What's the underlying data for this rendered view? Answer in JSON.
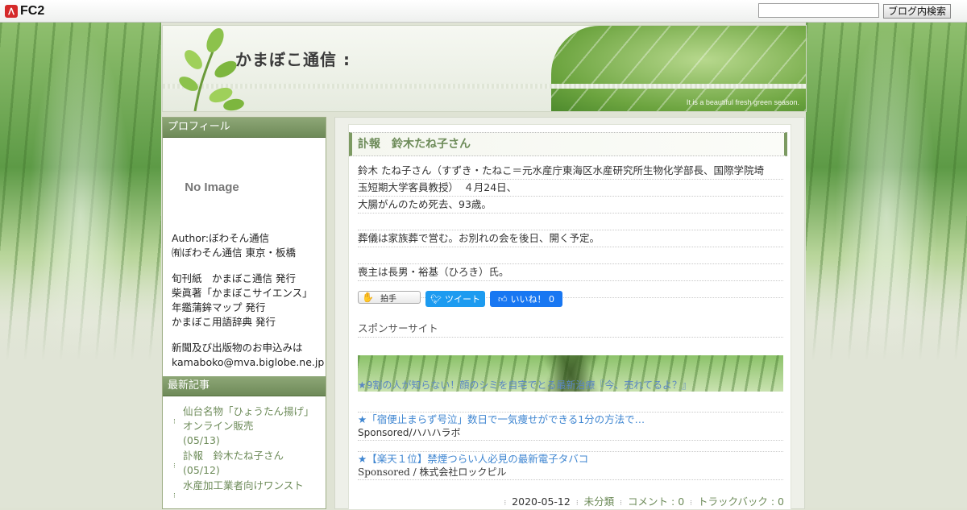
{
  "fc2_bar": {
    "logo_text": "FC2",
    "search_placeholder": "",
    "search_button": "ブログ内検索"
  },
  "header": {
    "site_title": "かまぼこ通信 :",
    "tagline": "It is a beautiful fresh green season."
  },
  "sidebar": {
    "profile_heading": "プロフィール",
    "no_image_text": "No Image",
    "author_lines": [
      "Author:ぼわそん通信",
      "㈲ぼわそん通信 東京・板橋"
    ],
    "publication_lines": [
      "旬刊紙　かまぼこ通信 発行",
      "柴眞著「かまぼこサイエンス」",
      "年鑑蒲鉾マップ 発行",
      "かまぼこ用語辞典 発行"
    ],
    "contact_lines": [
      "新聞及び出版物のお申込みは",
      "kamaboko@mva.biglobe.ne.jp"
    ],
    "recent_heading": "最新記事",
    "recent_items": [
      {
        "title": "仙台名物「ひょうたん揚げ」　オンライン販売",
        "date": "(05/13)"
      },
      {
        "title": "訃報　鈴木たね子さん",
        "date": "(05/12)"
      },
      {
        "title": "水産加工業者向けワンスト",
        "date": ""
      }
    ]
  },
  "entry": {
    "title": "訃報　鈴木たね子さん",
    "body_lines": [
      "鈴木 たね子さん（すずき・たねこ＝元水産庁東海区水産研究所生物化学部長、国際学院埼",
      "玉短期大学客員教授）　４月24日、",
      "大腸がんのため死去、93歳。",
      "",
      "葬儀は家族葬で営む。お別れの会を後日、開く予定。",
      "",
      "喪主は長男・裕基（ひろき）氏。",
      ""
    ],
    "clap_label": "拍手",
    "tweet_label": "ツイート",
    "like_label": "いいね！ 0",
    "sponsor_heading": "スポンサーサイト",
    "banner_text": "★9割の人が知らない！顔のシミを自宅でとる最新治療『今、売れてるよ？』",
    "ads": [
      {
        "title": "★「宿便止まらず号泣」数日で一気痩せができる1分の方法で…",
        "sponsor": "Sponsored/ハハハラボ"
      },
      {
        "title": "★【楽天１位】禁煙つらい人必見の最新電子タバコ",
        "sponsor": "Sponsored / 株式会社ロックピル"
      }
    ],
    "meta": {
      "date": "2020-05-12",
      "category": "未分類",
      "comments": "コメント : 0",
      "trackbacks": "トラックバック : 0"
    }
  }
}
